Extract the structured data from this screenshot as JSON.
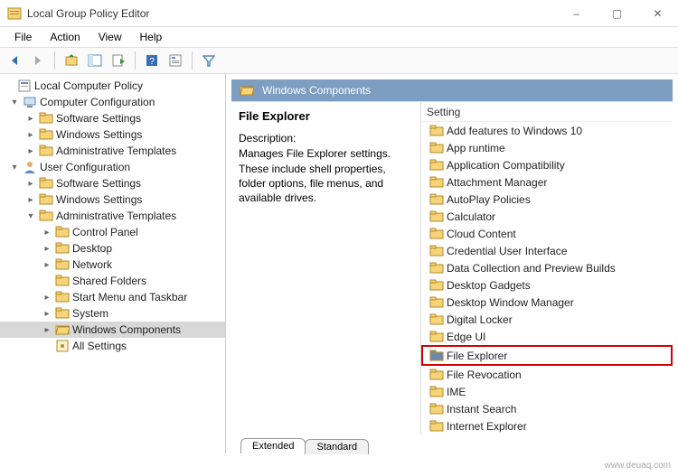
{
  "window": {
    "title": "Local Group Policy Editor",
    "minimize": "–",
    "maximize": "▢",
    "close": "✕"
  },
  "menu": {
    "file": "File",
    "action": "Action",
    "view": "View",
    "help": "Help"
  },
  "tree": {
    "root": "Local Computer Policy",
    "computer_cfg": "Computer Configuration",
    "cc_software": "Software Settings",
    "cc_windows": "Windows Settings",
    "cc_admin": "Administrative Templates",
    "user_cfg": "User Configuration",
    "uc_software": "Software Settings",
    "uc_windows": "Windows Settings",
    "uc_admin": "Administrative Templates",
    "control_panel": "Control Panel",
    "desktop": "Desktop",
    "network": "Network",
    "shared_folders": "Shared Folders",
    "start_menu": "Start Menu and Taskbar",
    "system": "System",
    "win_components": "Windows Components",
    "all_settings": "All Settings"
  },
  "crumb": {
    "label": "Windows Components"
  },
  "desc": {
    "title": "File Explorer",
    "label": "Description:",
    "text": "Manages File Explorer settings. These include shell properties, folder options, file menus, and available drives."
  },
  "list": {
    "header": "Setting",
    "items": [
      "Add features to Windows 10",
      "App runtime",
      "Application Compatibility",
      "Attachment Manager",
      "AutoPlay Policies",
      "Calculator",
      "Cloud Content",
      "Credential User Interface",
      "Data Collection and Preview Builds",
      "Desktop Gadgets",
      "Desktop Window Manager",
      "Digital Locker",
      "Edge UI",
      "File Explorer",
      "File Revocation",
      "IME",
      "Instant Search",
      "Internet Explorer"
    ],
    "highlighted_index": 13
  },
  "tabs": {
    "extended": "Extended",
    "standard": "Standard"
  },
  "watermark": "www.deuaq.com"
}
